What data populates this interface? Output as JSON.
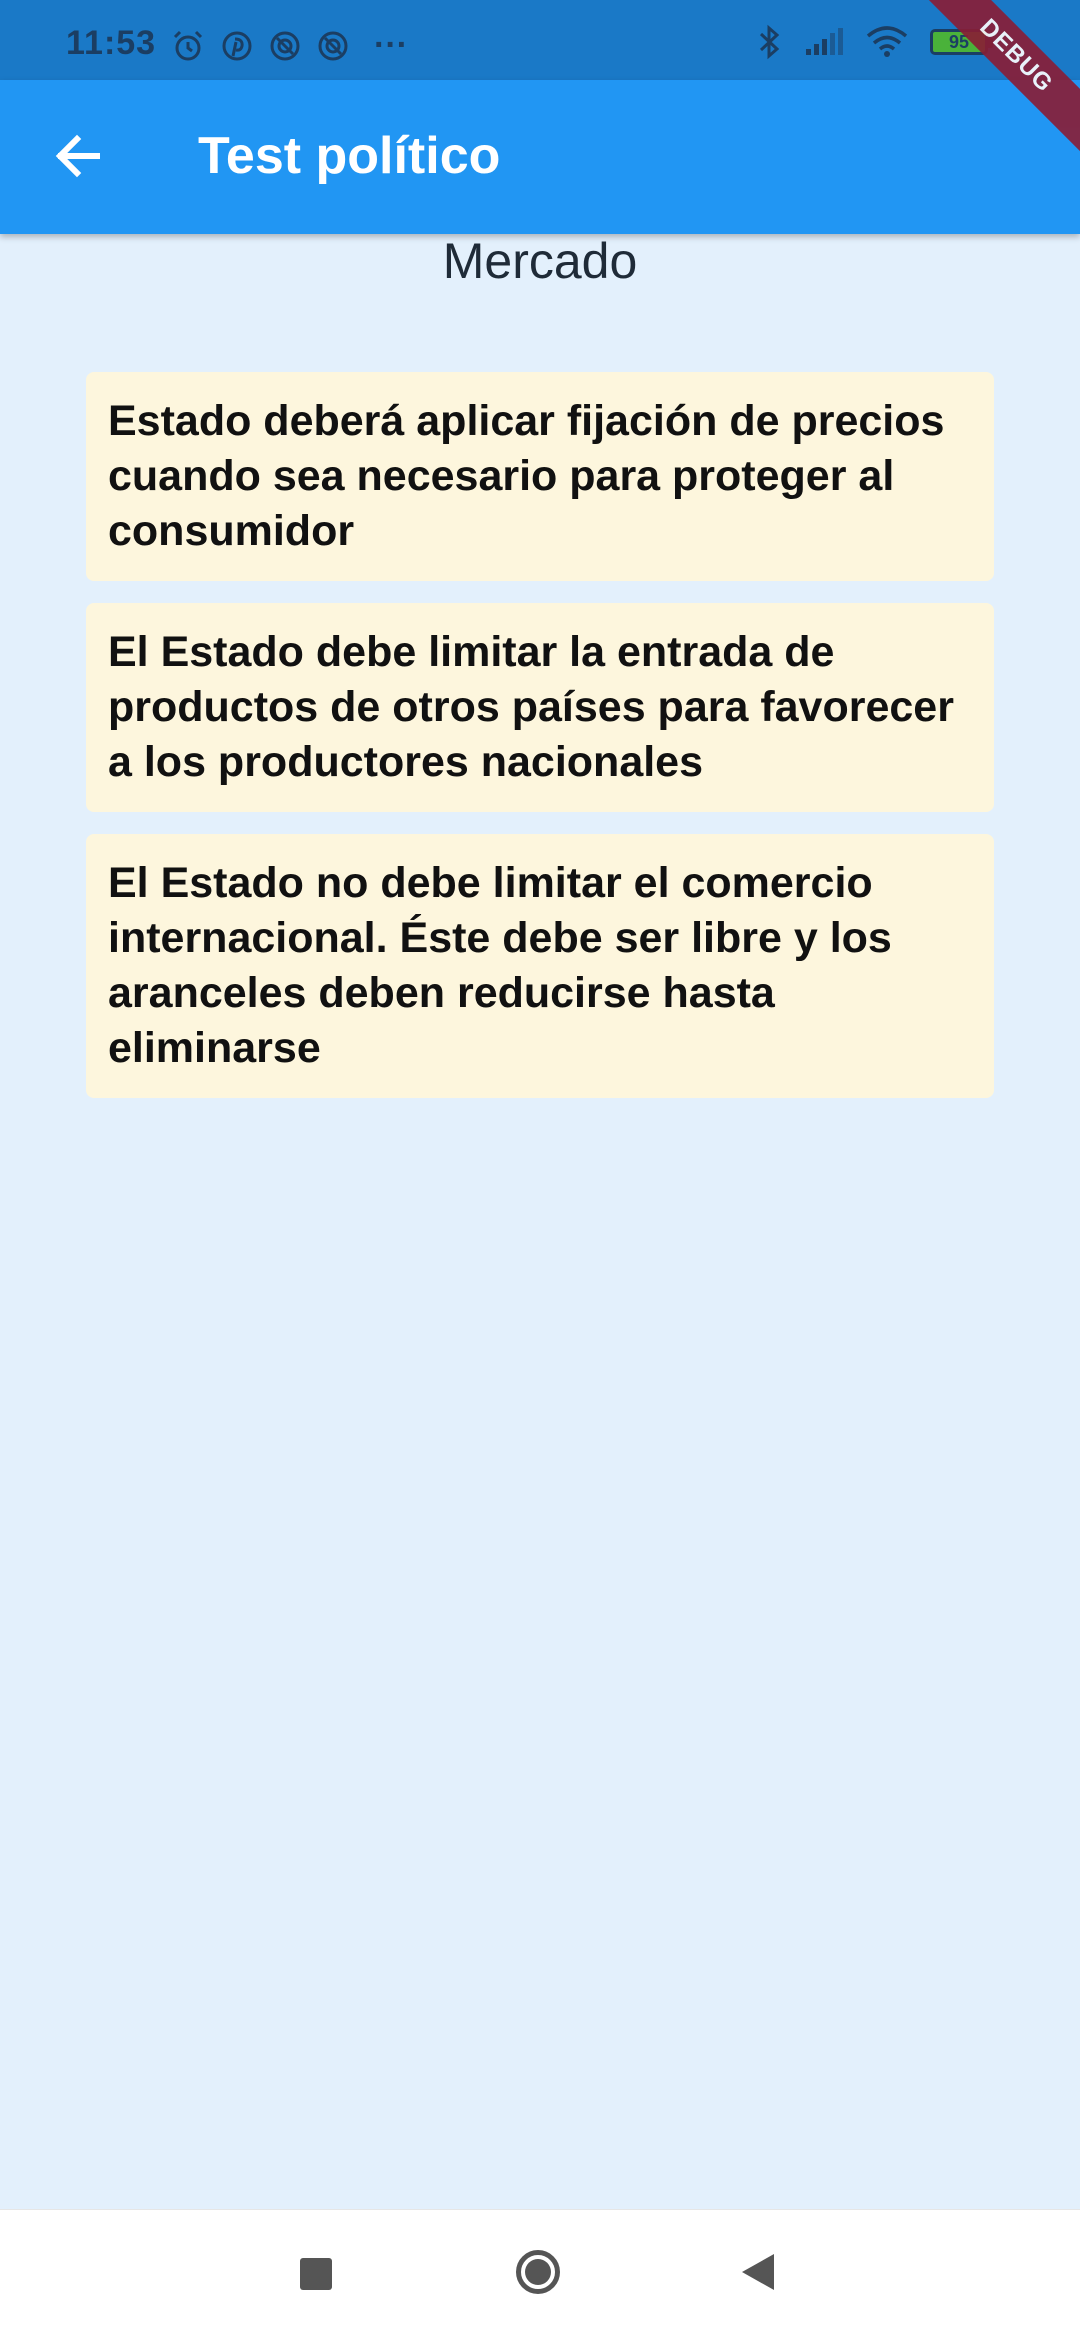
{
  "status_bar": {
    "time": "11:53",
    "more": "···",
    "battery": "95",
    "left_icons": [
      "alarm-icon",
      "pinterest-icon",
      "blocked-icon",
      "blocked-icon"
    ],
    "right_icons": [
      "bluetooth-icon",
      "signal-icon",
      "wifi-icon",
      "battery-icon"
    ]
  },
  "app_bar": {
    "title": "Test político",
    "back_icon": "arrow-left-icon",
    "background": "#2196f3"
  },
  "debug_banner": "DEBUG",
  "section": {
    "title": "Mercado"
  },
  "options": [
    {
      "text": "Estado deberá aplicar fijación de precios cuando sea necesario para proteger al consumidor"
    },
    {
      "text": "El Estado debe limitar la entrada de productos de otros países para favorecer a los productores nacionales"
    },
    {
      "text": "El Estado no debe limitar el comercio internacional. Éste debe ser libre y los aranceles deben reducirse hasta eliminarse"
    }
  ],
  "colors": {
    "page_background": "#e3f0fc",
    "card_background": "#fdf6dd"
  },
  "nav_bar": [
    "recents-icon",
    "home-icon",
    "back-icon"
  ]
}
